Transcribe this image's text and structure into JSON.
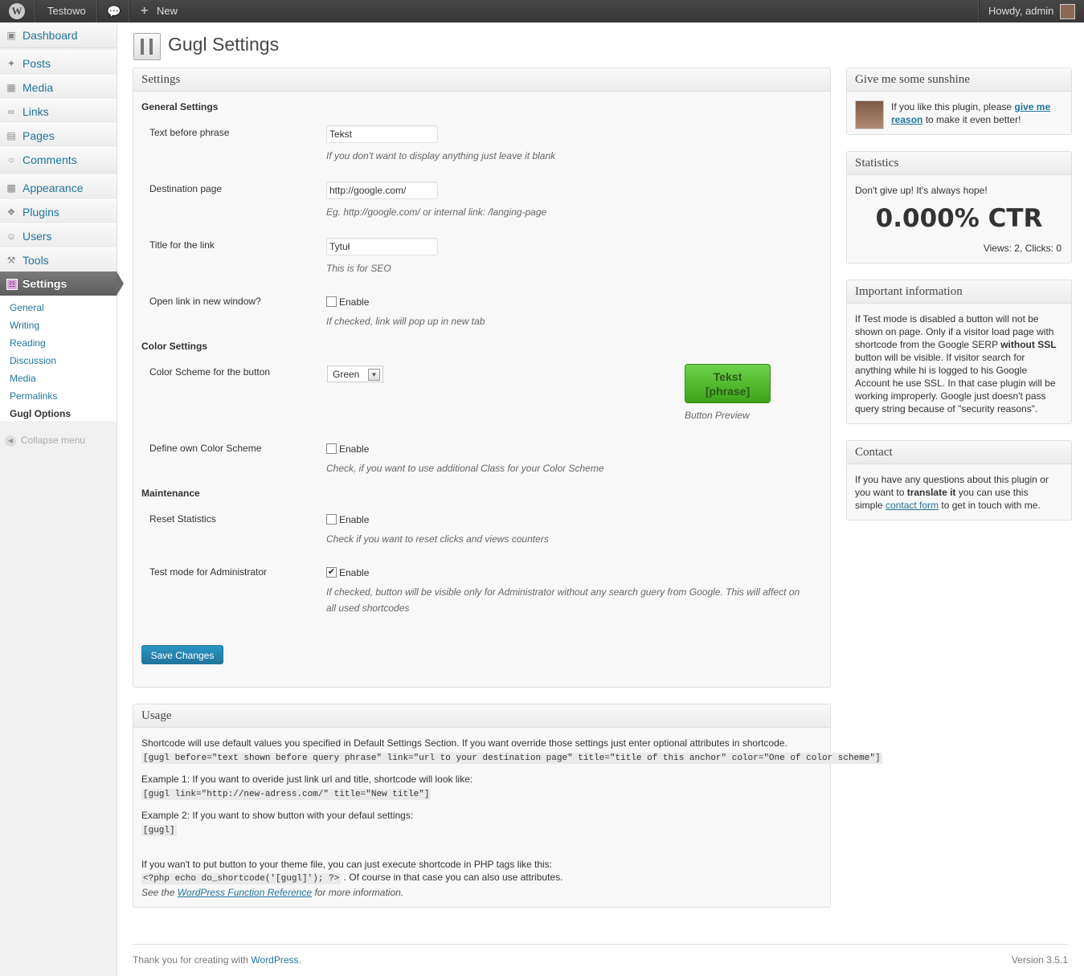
{
  "adminbar": {
    "site_name": "Testowo",
    "new_label": "New",
    "howdy": "Howdy, admin"
  },
  "sidebar": {
    "items": [
      {
        "label": "Dashboard",
        "icon": "dashboard-icon"
      },
      {
        "label": "Posts",
        "icon": "posts-pin-icon"
      },
      {
        "label": "Media",
        "icon": "media-icon"
      },
      {
        "label": "Links",
        "icon": "links-icon"
      },
      {
        "label": "Pages",
        "icon": "pages-icon"
      },
      {
        "label": "Comments",
        "icon": "comments-icon"
      },
      {
        "label": "Appearance",
        "icon": "appearance-icon"
      },
      {
        "label": "Plugins",
        "icon": "plugins-icon"
      },
      {
        "label": "Users",
        "icon": "users-icon"
      },
      {
        "label": "Tools",
        "icon": "tools-icon"
      },
      {
        "label": "Settings",
        "icon": "settings-icon"
      }
    ],
    "submenu": [
      "General",
      "Writing",
      "Reading",
      "Discussion",
      "Media",
      "Permalinks",
      "Gugl Options"
    ],
    "collapse": "Collapse menu"
  },
  "page": {
    "title": "Gugl Settings"
  },
  "settings": {
    "box_title": "Settings",
    "general_heading": "General Settings",
    "text_before_label": "Text before phrase",
    "text_before_value": "Tekst",
    "text_before_desc": "If you don't want to display anything just leave it blank",
    "destination_label": "Destination page",
    "destination_value": "http://google.com/",
    "destination_desc": "Eg. http://google.com/ or internal link: /langing-page",
    "title_label": "Title for the link",
    "title_value": "Tytuł",
    "title_desc": "This is for SEO",
    "new_window_label": "Open link in new window?",
    "new_window_checked": false,
    "new_window_desc": "If checked, link will pop up in new tab",
    "color_heading": "Color Settings",
    "scheme_label": "Color Scheme for the button",
    "scheme_value": "Green",
    "preview_line1": "Tekst",
    "preview_line2": "[phrase]",
    "preview_caption": "Button Preview",
    "own_scheme_label": "Define own Color Scheme",
    "own_scheme_checked": false,
    "own_scheme_desc": "Check, if you want to use additional Class for your Color Scheme",
    "maintenance_heading": "Maintenance",
    "reset_label": "Reset Statistics",
    "reset_checked": false,
    "reset_desc": "Check if you want to reset clicks and views counters",
    "testmode_label": "Test mode for Administrator",
    "testmode_checked": true,
    "testmode_desc1": "If checked, button will be visible only for Administrator without any search guery from Google. This will affect on",
    "testmode_desc2": "all used shortcodes",
    "enable": "Enable",
    "save_label": "Save Changes"
  },
  "usage": {
    "box_title": "Usage",
    "intro": "Shortcode will use default values you specified in Default Settings Section. If you want override those settings just enter optional attributes in shortcode.",
    "intro_code": "[gugl before=\"text shown before query phrase\" link=\"url to your destination page\" title=\"title of this anchor\" color=\"One of color scheme\"]",
    "ex1": "Example 1: If you want to overide just link url and title, shortcode will look like:",
    "ex1_code": "[gugl link=\"http://new-adress.com/\" title=\"New title\"]",
    "ex2": "Example 2: If you want to show button with your defaul settings:",
    "ex2_code": "[gugl]",
    "php_intro": "If you wan't to put button to your theme file, you can just execute shortcode in PHP tags like this:",
    "php_code": "<?php echo do_shortcode('[gugl]'); ?>",
    "php_after": ". Of course in that case you can also use attributes.",
    "see_pre": "See the ",
    "see_link": "WordPress Function Reference",
    "see_post": " for more information."
  },
  "sunshine": {
    "box_title": "Give me some sunshine",
    "text_pre": "If you like this plugin, please ",
    "link_line1": "give me",
    "link_line2": "reason",
    "text_post": " to make it even better!"
  },
  "statistics": {
    "box_title": "Statistics",
    "hope": "Don't give up! It's always hope!",
    "ctr": "0.000% CTR",
    "views_clicks": "Views: 2, Clicks: 0"
  },
  "important": {
    "box_title": "Important information",
    "lines": [
      "If Test mode is disabled a button will not be",
      "shown on page. Only if a visitor load page with",
      "shortcode from the Google SERP ",
      "button will be visible. If visitor search for",
      "anything while hi is logged to his Google",
      "Account he use SSL. In that case plugin will be",
      "working improperly. Google just doesn't pass",
      "query string because of \"security reasons\"."
    ],
    "bold": "without SSL"
  },
  "contact": {
    "box_title": "Contact",
    "line1": "If you have any questions about this plugin or",
    "line2_pre": "you want to ",
    "line2_bold": "translate it",
    "line2_post": " you can use this",
    "line3_pre": "simple ",
    "line3_link": "contact form",
    "line3_post": " to get in touch with me."
  },
  "footer": {
    "thanks_pre": "Thank you for creating with ",
    "thanks_link": "WordPress",
    "thanks_post": ".",
    "version": "Version 3.5.1"
  }
}
